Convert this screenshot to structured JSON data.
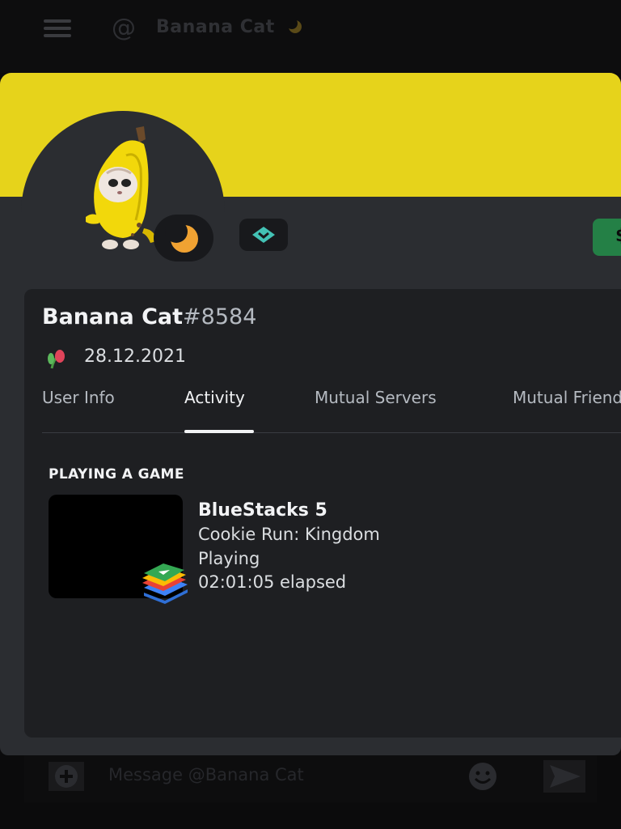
{
  "header": {
    "title": "Banana Cat",
    "menu_icon": "hamburger-icon",
    "mention_icon": "at-icon",
    "status_icon": "moon-icon"
  },
  "profile": {
    "banner_color": "#e6d31b",
    "status": "idle",
    "name": "Banana Cat",
    "discriminator": "#8584",
    "member_since": "28.12.2021",
    "badge_icon": "hypesquad-badge-icon",
    "action_button": "$"
  },
  "tabs": [
    {
      "label": "User Info",
      "active": false
    },
    {
      "label": "Activity",
      "active": true
    },
    {
      "label": "Mutual Servers",
      "active": false
    },
    {
      "label": "Mutual Friends",
      "active": false
    }
  ],
  "activity": {
    "section_label": "PLAYING A GAME",
    "title": "BlueStacks 5",
    "details": "Cookie Run: Kingdom",
    "state": "Playing",
    "elapsed": "02:01:05 elapsed"
  },
  "composer": {
    "placeholder": "Message @Banana Cat"
  },
  "colors": {
    "accent_green": "#248046",
    "idle": "#f0a232",
    "badge_teal": "#43c2b5"
  }
}
